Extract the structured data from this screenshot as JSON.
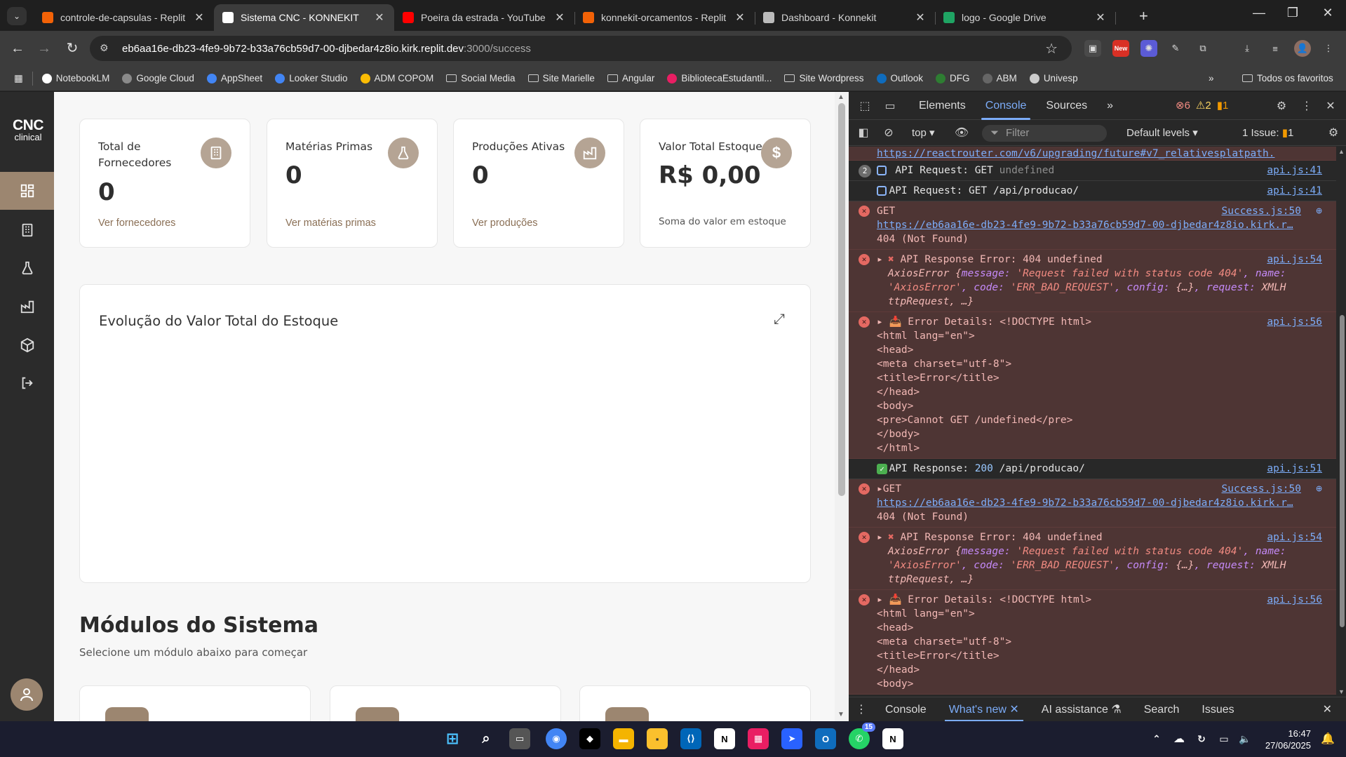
{
  "browser": {
    "tabs_button_icon": "chevron-down-icon",
    "tabs": [
      {
        "title": "controle-de-capsulas - Replit",
        "favicon_color": "#f26207",
        "active": false
      },
      {
        "title": "Sistema CNC - KONNEKIT",
        "favicon_color": "#ffffff",
        "active": true
      },
      {
        "title": "Poeira da estrada - YouTube",
        "favicon_color": "#ff0000",
        "active": false
      },
      {
        "title": "konnekit-orcamentos - Replit",
        "favicon_color": "#f26207",
        "active": false
      },
      {
        "title": "Dashboard - Konnekit",
        "favicon_color": "#bbbbbb",
        "active": false
      },
      {
        "title": "logo - Google Drive",
        "favicon_color": "#1fa463",
        "active": false
      }
    ],
    "url_host": "eb6aa16e-db23-4fe9-9b72-b33a76cb59d7-00-djbedar4z8io.kirk.replit.dev",
    "url_path": ":3000/success",
    "ext_badge": "New",
    "bookmarks": [
      {
        "label": "NotebookLM",
        "icon": "notebooklm-icon",
        "color": "#ffffff"
      },
      {
        "label": "Google Cloud",
        "icon": "cloud-icon",
        "color": "#8a8a8a"
      },
      {
        "label": "AppSheet",
        "icon": "appsheet-icon",
        "color": "#4285f4"
      },
      {
        "label": "Looker Studio",
        "icon": "looker-icon",
        "color": "#4285f4"
      },
      {
        "label": "ADM COPOM",
        "icon": "drive-icon",
        "color": "#fbbc04"
      },
      {
        "label": "Social Media",
        "icon": "folder-icon",
        "color": ""
      },
      {
        "label": "Site Marielle",
        "icon": "folder-icon",
        "color": ""
      },
      {
        "label": "Angular",
        "icon": "folder-icon",
        "color": ""
      },
      {
        "label": "BibliotecaEstudantil...",
        "icon": "bookmark-icon",
        "color": "#e91e63"
      },
      {
        "label": "Site Wordpress",
        "icon": "folder-icon",
        "color": ""
      },
      {
        "label": "Outlook",
        "icon": "outlook-icon",
        "color": "#0f6cbd"
      },
      {
        "label": "DFG",
        "icon": "dfg-icon",
        "color": "#2e7d32"
      },
      {
        "label": "ABM",
        "icon": "abm-icon",
        "color": "#666666"
      },
      {
        "label": "Univesp",
        "icon": "globe-icon",
        "color": "#cccccc"
      }
    ],
    "all_bookmarks": "Todos os favoritos"
  },
  "app": {
    "brand_top": "CNC",
    "brand_bottom": "clinical",
    "accent": "#9c8670",
    "stats": [
      {
        "title": "Total de\nFornecedores",
        "value": "0",
        "link": "Ver fornecedores",
        "icon": "building-icon"
      },
      {
        "title": "Matérias Primas",
        "value": "0",
        "link": "Ver matérias primas",
        "icon": "flask-icon"
      },
      {
        "title": "Produções Ativas",
        "value": "0",
        "link": "Ver produções",
        "icon": "factory-icon"
      },
      {
        "title": "Valor Total Estoque",
        "value": "R$ 0,00",
        "link": "Soma do valor em estoque",
        "icon": "dollar-icon"
      }
    ],
    "chart_title": "Evolução do Valor Total do Estoque",
    "modules_title": "Módulos do Sistema",
    "modules_subtitle": "Selecione um módulo abaixo para começar"
  },
  "devtools": {
    "tabs": [
      "Elements",
      "Console",
      "Sources"
    ],
    "active_tab": "Console",
    "errors": "6",
    "warnings": "2",
    "issues_count": "1",
    "context": "top",
    "filter_placeholder": "Filter",
    "levels": "Default levels",
    "issue_label": "1 Issue:",
    "issue_num": "1",
    "drawer_tabs": [
      "Console",
      "What's new",
      "AI assistance",
      "Search",
      "Issues"
    ],
    "console": {
      "r0_url": "https://reactrouter.com/v6/upgrading/future#v7_relativesplatpath.",
      "r1_count": "2",
      "r1_text": "API Request: GET",
      "r1_muted": "undefined",
      "r1_src": "api.js:41",
      "r2_text": "API Request: GET /api/producao/",
      "r2_src": "api.js:41",
      "get": "GET",
      "success_src": "Success.js:50",
      "failed_url": "https://eb6aa16e-db23-4fe9-9b72-b33a76cb59d7-00-djbedar4z8io.kirk.r…",
      "not_found": "404 (Not Found)",
      "resp_err": "API Response Error: 404 undefined",
      "resp_src": "api.js:54",
      "axios_l1a": "AxiosError {",
      "axios_k_message": "message:",
      "axios_v_message": "'Request failed with status code 404'",
      "axios_k_name": ", name:",
      "axios_v_name": "'AxiosError'",
      "axios_k_code": ", code:",
      "axios_v_code": "'ERR_BAD_REQUEST'",
      "axios_k_config": ", config:",
      "axios_v_config": "{…}",
      "axios_k_request": ", request:",
      "axios_v_request1": "XMLH",
      "axios_v_request2": "ttpRequest, …}",
      "details": "Error Details: <!DOCTYPE html>",
      "details_src": "api.js:56",
      "html_lines": [
        "<html lang=\"en\">",
        "<head>",
        "<meta charset=\"utf-8\">",
        "<title>Error</title>",
        "</head>",
        "<body>",
        "<pre>Cannot GET /undefined</pre>",
        "</body>",
        "</html>"
      ],
      "resp_ok_prefix": "API Response:",
      "resp_ok_code": "200",
      "resp_ok_path": "/api/producao/",
      "resp_ok_src": "api.js:51"
    }
  },
  "taskbar": {
    "whatsapp_badge": "15",
    "time": "16:47",
    "date": "27/06/2025"
  }
}
